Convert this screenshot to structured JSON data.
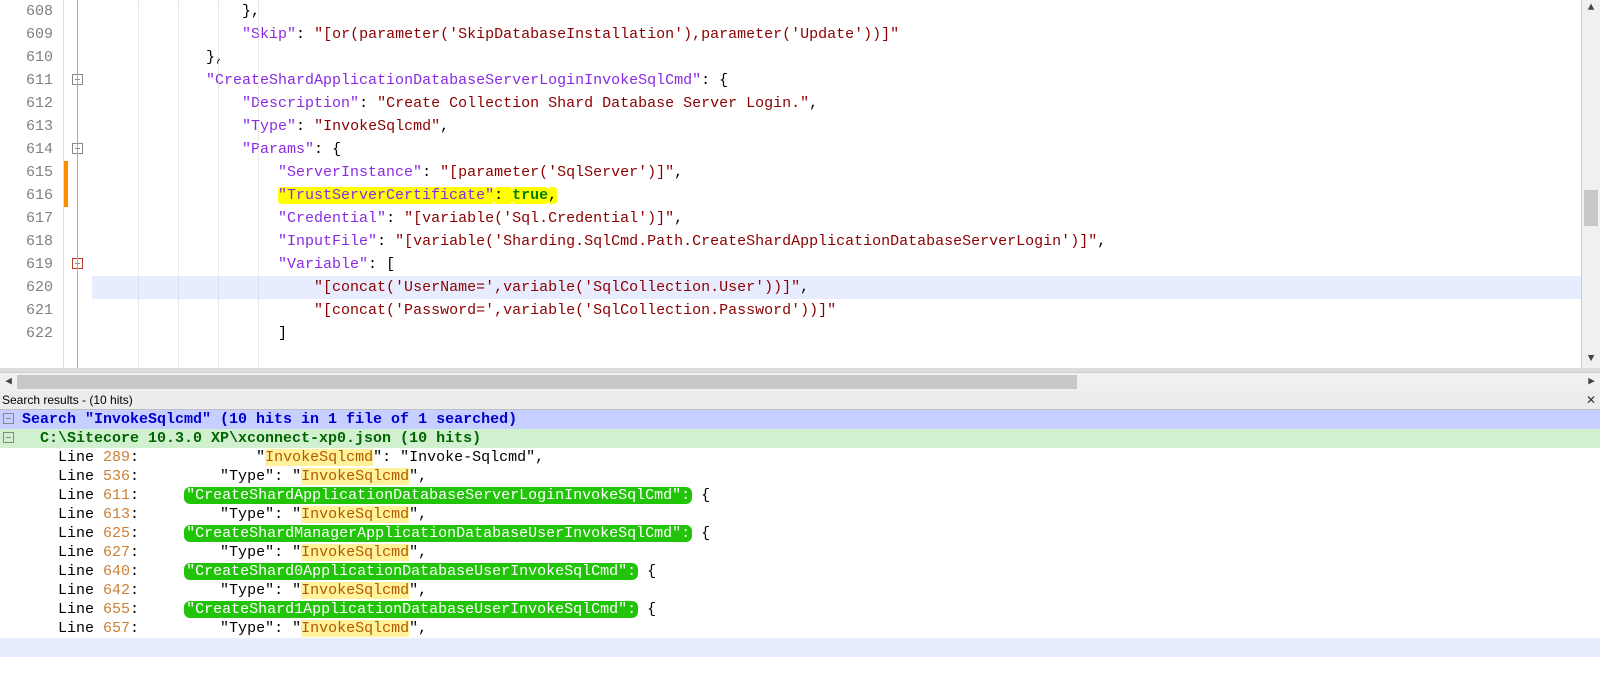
{
  "editor": {
    "lines": [
      {
        "num": 608,
        "indent": 16,
        "tokens": [
          {
            "t": "brace",
            "v": "},"
          }
        ]
      },
      {
        "num": 609,
        "indent": 16,
        "tokens": [
          {
            "t": "key",
            "v": "\"Skip\""
          },
          {
            "t": "punc",
            "v": ": "
          },
          {
            "t": "str",
            "v": "\"[or(parameter('SkipDatabaseInstallation'),parameter('Update'))]\""
          }
        ]
      },
      {
        "num": 610,
        "indent": 12,
        "tokens": [
          {
            "t": "brace",
            "v": "},"
          }
        ]
      },
      {
        "num": 611,
        "indent": 12,
        "tokens": [
          {
            "t": "key",
            "v": "\"CreateShardApplicationDatabaseServerLoginInvokeSqlCmd\""
          },
          {
            "t": "punc",
            "v": ": "
          },
          {
            "t": "brace",
            "v": "{"
          }
        ],
        "foldbox": true
      },
      {
        "num": 612,
        "indent": 16,
        "tokens": [
          {
            "t": "key",
            "v": "\"Description\""
          },
          {
            "t": "punc",
            "v": ": "
          },
          {
            "t": "str",
            "v": "\"Create Collection Shard Database Server Login.\""
          },
          {
            "t": "punc",
            "v": ","
          }
        ]
      },
      {
        "num": 613,
        "indent": 16,
        "tokens": [
          {
            "t": "key",
            "v": "\"Type\""
          },
          {
            "t": "punc",
            "v": ": "
          },
          {
            "t": "str",
            "v": "\"InvokeSqlcmd\""
          },
          {
            "t": "punc",
            "v": ","
          }
        ]
      },
      {
        "num": 614,
        "indent": 16,
        "tokens": [
          {
            "t": "key",
            "v": "\"Params\""
          },
          {
            "t": "punc",
            "v": ": "
          },
          {
            "t": "brace",
            "v": "{"
          }
        ],
        "foldbox": true
      },
      {
        "num": 615,
        "indent": 20,
        "tokens": [
          {
            "t": "key",
            "v": "\"ServerInstance\""
          },
          {
            "t": "punc",
            "v": ": "
          },
          {
            "t": "str",
            "v": "\"[parameter('SqlServer')]\""
          },
          {
            "t": "punc",
            "v": ","
          }
        ],
        "change": true
      },
      {
        "num": 616,
        "indent": 20,
        "tokens": [
          {
            "t": "key",
            "v": "\"TrustServerCertificate\"",
            "hl": "yellow"
          },
          {
            "t": "punc",
            "v": ": ",
            "hl": "yellow"
          },
          {
            "t": "bool",
            "v": "true",
            "hl": "yellow"
          },
          {
            "t": "punc",
            "v": ",",
            "hl": "yellow"
          }
        ],
        "change": true
      },
      {
        "num": 617,
        "indent": 20,
        "tokens": [
          {
            "t": "key",
            "v": "\"Credential\""
          },
          {
            "t": "punc",
            "v": ": "
          },
          {
            "t": "str",
            "v": "\"[variable('Sql.Credential')]\""
          },
          {
            "t": "punc",
            "v": ","
          }
        ]
      },
      {
        "num": 618,
        "indent": 20,
        "tokens": [
          {
            "t": "key",
            "v": "\"InputFile\""
          },
          {
            "t": "punc",
            "v": ": "
          },
          {
            "t": "str",
            "v": "\"[variable('Sharding.SqlCmd.Path.CreateShardApplicationDatabaseServerLogin')]\""
          },
          {
            "t": "punc",
            "v": ","
          }
        ]
      },
      {
        "num": 619,
        "indent": 20,
        "tokens": [
          {
            "t": "key",
            "v": "\"Variable\""
          },
          {
            "t": "punc",
            "v": ": "
          },
          {
            "t": "brace",
            "v": "["
          }
        ],
        "foldbox": true,
        "foldcolor": "red"
      },
      {
        "num": 620,
        "indent": 24,
        "tokens": [
          {
            "t": "str",
            "v": "\"[concat('UserName=',variable('SqlCollection.User'))]\""
          },
          {
            "t": "punc",
            "v": ","
          }
        ],
        "current": true
      },
      {
        "num": 621,
        "indent": 24,
        "tokens": [
          {
            "t": "str",
            "v": "\"[concat('Password=',variable('SqlCollection.Password'))]\""
          }
        ]
      },
      {
        "num": 622,
        "indent": 20,
        "tokens": [
          {
            "t": "brace",
            "v": "]"
          }
        ]
      }
    ]
  },
  "search": {
    "title": "Search results - (10 hits)",
    "header_search": "Search \"InvokeSqlcmd\" (10 hits in 1 file of 1 searched)",
    "header_file": "  C:\\Sitecore 10.3.0 XP\\xconnect-xp0.json (10 hits)",
    "results": [
      {
        "line": 289,
        "prefix": "            \"",
        "key": "InvokeSqlcmd",
        "keyHL": "soft",
        "suffix": "\": \"Invoke-Sqlcmd\","
      },
      {
        "line": 536,
        "prefix": "        \"Type\": \"",
        "key": "InvokeSqlcmd",
        "keyHL": "soft",
        "suffix": "\","
      },
      {
        "line": 611,
        "greenKey": "\"CreateShardApplicationDatabaseServerLoginInvokeSqlCmd\":",
        "after": " {"
      },
      {
        "line": 613,
        "prefix": "        \"Type\": \"",
        "key": "InvokeSqlcmd",
        "keyHL": "soft",
        "suffix": "\","
      },
      {
        "line": 625,
        "greenKey": "\"CreateShardManagerApplicationDatabaseUserInvokeSqlCmd\":",
        "after": " {"
      },
      {
        "line": 627,
        "prefix": "        \"Type\": \"",
        "key": "InvokeSqlcmd",
        "keyHL": "soft",
        "suffix": "\","
      },
      {
        "line": 640,
        "greenKey": "\"CreateShard0ApplicationDatabaseUserInvokeSqlCmd\":",
        "after": " {"
      },
      {
        "line": 642,
        "prefix": "        \"Type\": \"",
        "key": "InvokeSqlcmd",
        "keyHL": "soft",
        "suffix": "\","
      },
      {
        "line": 655,
        "greenKey": "\"CreateShard1ApplicationDatabaseUserInvokeSqlCmd\":",
        "after": " {"
      },
      {
        "line": 657,
        "prefix": "        \"Type\": \"",
        "key": "InvokeSqlcmd",
        "keyHL": "soft",
        "suffix": "\","
      }
    ],
    "line_label": "Line ",
    "colon": ":"
  }
}
